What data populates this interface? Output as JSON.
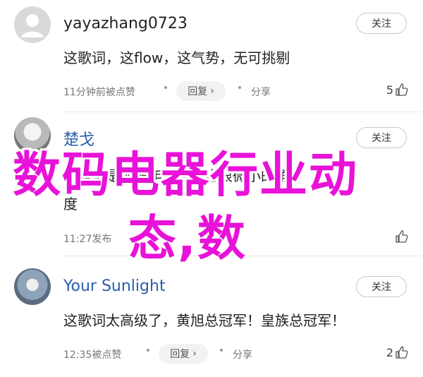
{
  "comments": [
    {
      "username": "yayazhang0723",
      "follow_label": "关注",
      "text": "这歌词，这flow，这气势，无可挑剔",
      "time": "11分钟前被点赞",
      "reply_label": "回复",
      "reply_chevron": "›",
      "share_label": "分享",
      "likes": "5"
    },
    {
      "username": "楚戈",
      "follow_label": "关注",
      "text_line1": "黄旭这是那些年连实力也很微小的角",
      "text_line2": "度",
      "time": "11:27发布",
      "likes": ""
    },
    {
      "username": "Your Sunlight",
      "follow_label": "关注",
      "text": "这歌词太高级了，黄旭总冠军！皇族总冠军！",
      "time": "12:35被点赞",
      "reply_label": "回复",
      "reply_chevron": "›",
      "share_label": "分享",
      "likes": "2"
    }
  ],
  "overlay": {
    "line1": "数码电器行业动",
    "line2": "态,数",
    "color": "#e812d8"
  },
  "icons": {
    "like": "thumbs-up-icon",
    "share": "share-dot-icon",
    "avatar_default": "default-person-icon"
  }
}
